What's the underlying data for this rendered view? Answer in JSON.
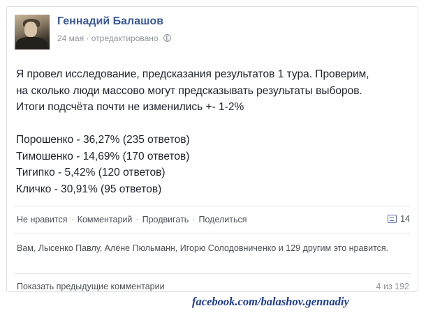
{
  "post": {
    "author": "Геннадий Балашов",
    "date": "24 мая",
    "meta_sep": " · ",
    "edited": "отредактировано",
    "privacy_icon": "globe-icon",
    "lines": [
      "Я провел исследование, предсказания результатов 1 тура. Проверим,",
      "на сколько люди массово могут предсказывать результаты выборов.",
      "Итоги подсчёта почти не изменились +- 1-2%"
    ],
    "results": [
      "Порошенко - 36,27% (235 ответов)",
      "Тимошенко - 14,69% (170 ответов)",
      "Тигипко - 5,42% (120 ответов)",
      "Кличко - 30,91% (95 ответов)"
    ]
  },
  "actions": {
    "unlike": "Не нравится",
    "comment": "Комментарий",
    "promote": "Продвигать",
    "share": "Поделиться",
    "separator": "·",
    "comment_icon": "comment-icon",
    "comment_count": "14"
  },
  "likes": {
    "text": "Вам, Лысенко Павлу, Алёне Пюльманн, Игорю Солодовниченко и 129 другим это нравится."
  },
  "comments": {
    "show_previous": "Показать предыдущие комментарии",
    "count": "4 из 192"
  },
  "watermark": "facebook.com/balashov.gennadiy",
  "colors": {
    "link": "#3b5998",
    "text": "#1d2129",
    "muted": "#90949c",
    "watermark": "#1f3d8f"
  }
}
